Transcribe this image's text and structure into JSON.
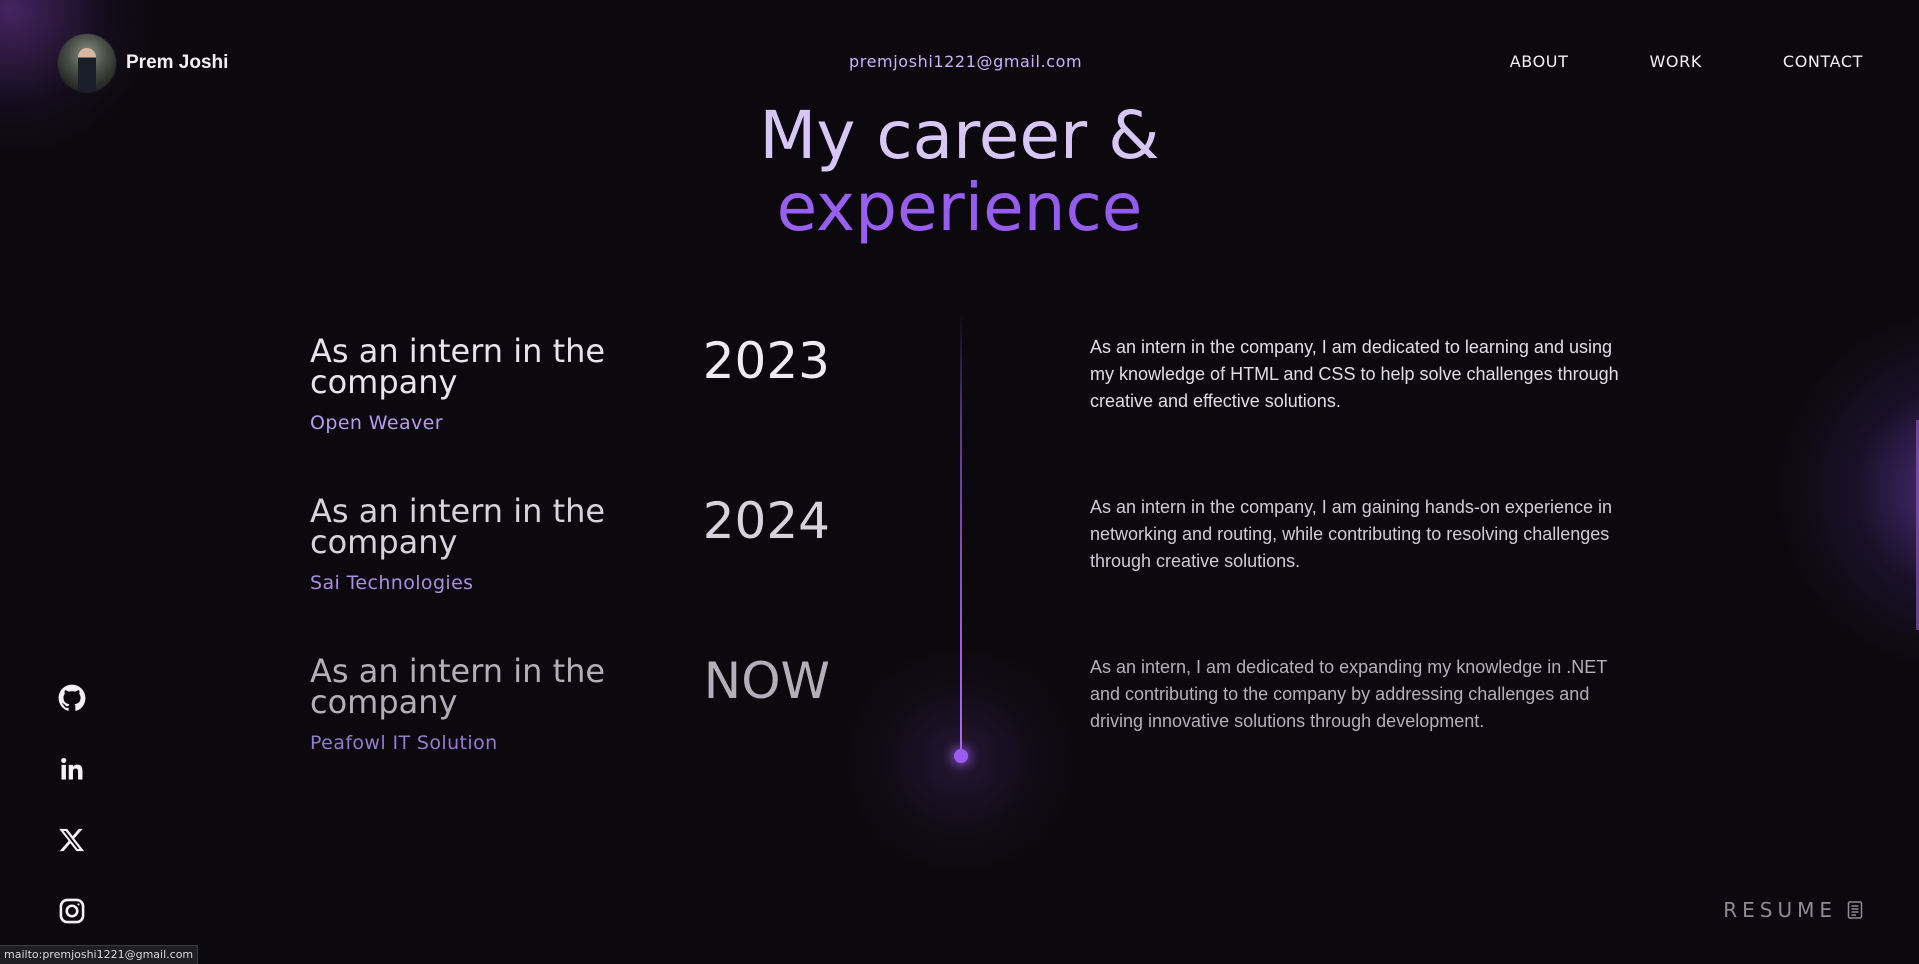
{
  "header": {
    "brand_name": "Prem Joshi",
    "email": "premjoshi1221@gmail.com",
    "nav": [
      {
        "label": "ABOUT"
      },
      {
        "label": "WORK"
      },
      {
        "label": "CONTACT"
      }
    ]
  },
  "title": {
    "line1": "My career &",
    "line2": "experience"
  },
  "experience": [
    {
      "role": "As an intern in the company",
      "company": "Open Weaver",
      "year": "2023",
      "description": "As an intern in the company, I am dedicated to learning and using my knowledge of HTML and CSS to help solve challenges through creative and effective solutions."
    },
    {
      "role": "As an intern in the company",
      "company": "Sai Technologies",
      "year": "2024",
      "description": "As an intern in the company, I am gaining hands-on experience in networking and routing, while contributing to resolving challenges through creative solutions."
    },
    {
      "role": "As an intern in the company",
      "company": "Peafowl IT Solution",
      "year": "NOW",
      "description": "As an intern, I am dedicated to expanding my knowledge in .NET and contributing to the company by addressing challenges and driving innovative solutions through development."
    }
  ],
  "socials": [
    {
      "icon": "github-icon"
    },
    {
      "icon": "linkedin-icon"
    },
    {
      "icon": "x-twitter-icon"
    },
    {
      "icon": "instagram-icon"
    }
  ],
  "resume": {
    "label": "RESUME",
    "icon": "document-icon"
  },
  "status_bar": {
    "text": "mailto:premjoshi1221@gmail.com"
  },
  "colors": {
    "background": "#0b090d",
    "accent": "#9c5cf0",
    "accent_light": "#c9b2fb"
  }
}
